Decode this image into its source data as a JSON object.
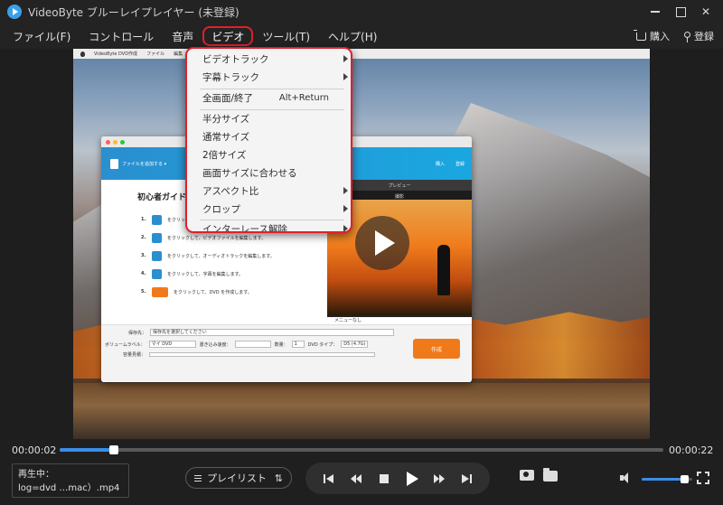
{
  "window": {
    "title": "VideoByte ブルーレイプレイヤー (未登録)"
  },
  "menubar": {
    "items": [
      "ファイル(F)",
      "コントロール",
      "音声",
      "ビデオ",
      "ツール(T)",
      "ヘルプ(H)"
    ],
    "active_item": "ビデオ",
    "buy_label": "購入",
    "register_label": "登録"
  },
  "video_menu": {
    "items": [
      {
        "label": "ビデオトラック",
        "submenu": true
      },
      {
        "label": "字幕トラック",
        "submenu": true
      },
      {
        "label": "全画面/終了",
        "shortcut": "Alt+Return"
      },
      {
        "label": "半分サイズ"
      },
      {
        "label": "通常サイズ"
      },
      {
        "label": "2倍サイズ"
      },
      {
        "label": "画面サイズに合わせる"
      },
      {
        "label": "アスペクト比",
        "submenu": true
      },
      {
        "label": "クロップ",
        "submenu": true
      },
      {
        "label": "インターレース解除",
        "submenu": true
      }
    ]
  },
  "video_frame": {
    "mac_menu": [
      "VideoByte DVD作成",
      "ファイル",
      "編集"
    ],
    "app_window": {
      "add_file_label": "ファイルを追加する ▾",
      "buy": "購入",
      "register": "登録",
      "guide_title": "初心者ガイド",
      "steps": [
        {
          "num": "1.",
          "text": "をクリックして、"
        },
        {
          "num": "2.",
          "text": "をクリックして、ビデオファイルを編集します。"
        },
        {
          "num": "3.",
          "text": "をクリックして、オーディオトラックを編集します。"
        },
        {
          "num": "4.",
          "text": "をクリックして、字幕を編集します。"
        },
        {
          "num": "5.",
          "text": "をクリックして、DVD を作成します。"
        }
      ],
      "preview_label": "プレビュー",
      "preview_chapter": "撮影",
      "menu_none": "メニューなし",
      "save_to_label": "保存先：",
      "save_to_value": "保存先を選択してください",
      "volume_label_label": "ボリュームラベル：",
      "volume_label_value": "マイ DVD",
      "write_speed_label": "書き込み速度：",
      "copies_label": "数量：",
      "copies_value": "1",
      "dvd_type_label": "DVD タイプ：",
      "dvd_type_value": "D5 (4.7G)",
      "capacity_label": "容量見積：",
      "create_label": "作成"
    }
  },
  "playback": {
    "current_time": "00:00:02",
    "total_time": "00:00:22",
    "progress": 0.09
  },
  "now_playing": {
    "label": "再生中：",
    "file": "log=dvd …mac）.mp4"
  },
  "playlist": {
    "label": "プレイリスト",
    "sort_icon": "⇅"
  },
  "volume": {
    "level": 0.84
  },
  "colors": {
    "accent": "#3a8ee6",
    "highlight": "#e0202a",
    "background": "#1f1f1f"
  }
}
